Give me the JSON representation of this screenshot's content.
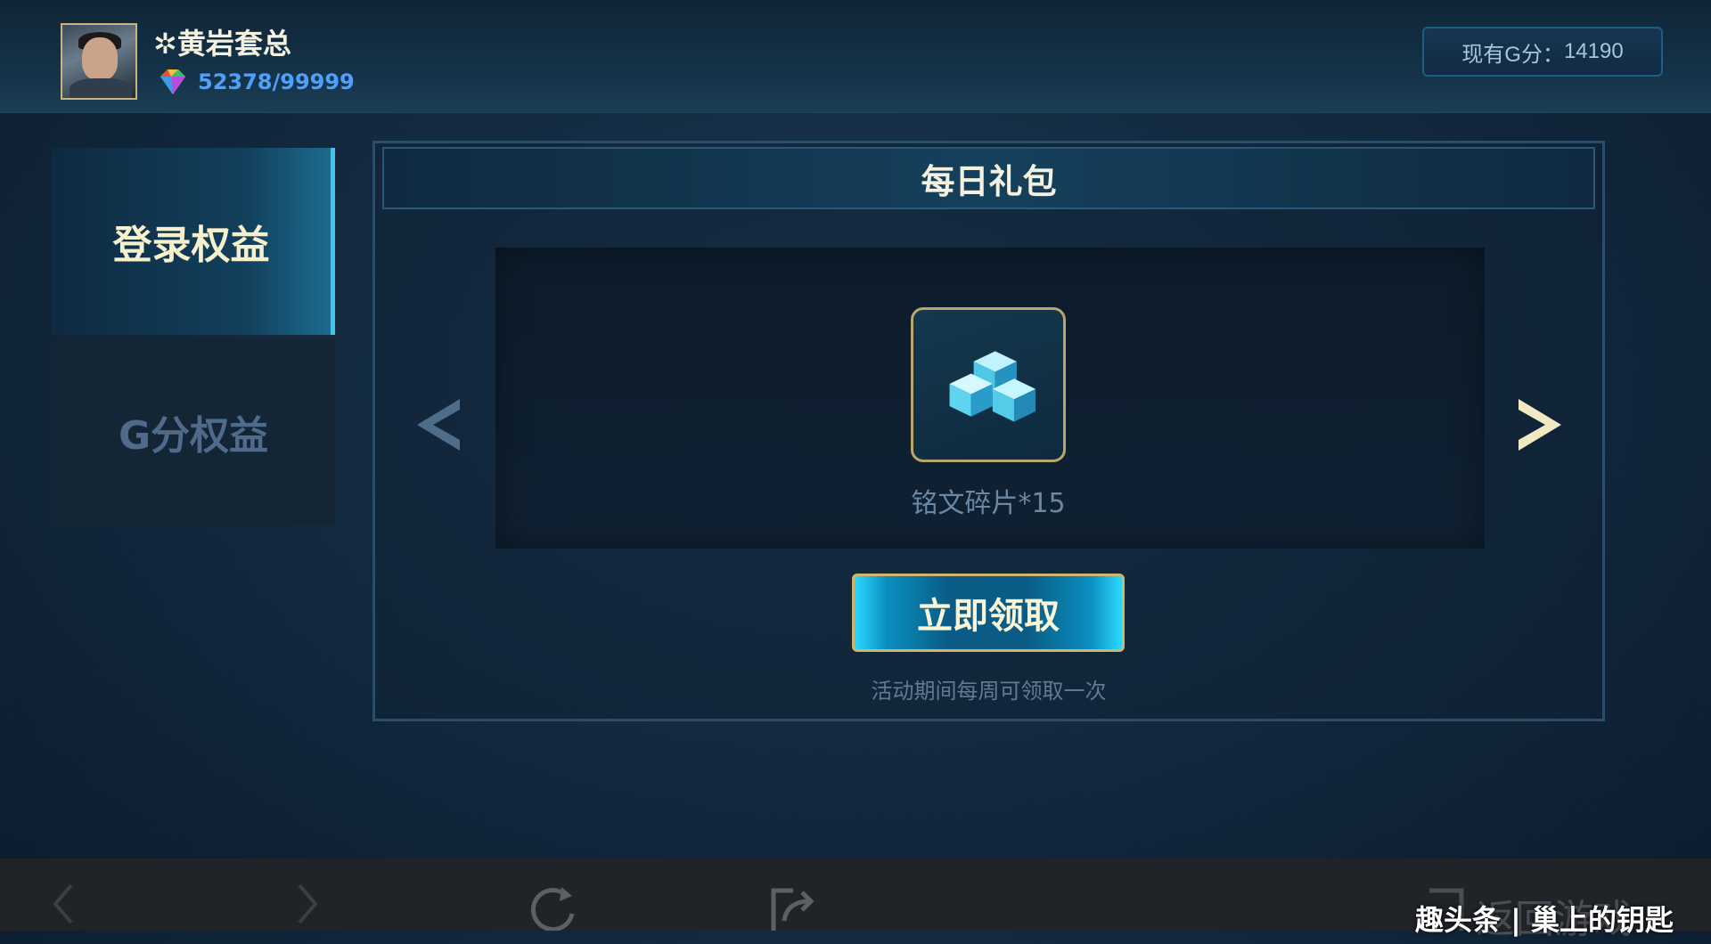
{
  "header": {
    "username": "✲黄岩套总",
    "progress": "52378/99999",
    "g_score_label": "现有G分：",
    "g_score_value": "14190"
  },
  "tabs": [
    {
      "label": "登录权益",
      "active": true
    },
    {
      "label": "G分权益",
      "active": false
    }
  ],
  "panel": {
    "title": "每日礼包",
    "item_name": "铭文碎片*15",
    "claim_label": "立即领取",
    "note": "活动期间每周可领取一次"
  },
  "bottom_bar": {
    "return_label": "返回游戏",
    "watermark": "趣头条 | 巢上的钥匙"
  },
  "colors": {
    "accent_gold": "#c9b57a",
    "accent_cyan": "#3fc4ee",
    "progress_blue": "#4ea0ff"
  },
  "icons": [
    "gem-icon",
    "arrow-left-icon",
    "arrow-right-icon",
    "cube-shard-icon",
    "back-icon",
    "forward-icon",
    "refresh-icon",
    "share-icon",
    "return-icon"
  ]
}
